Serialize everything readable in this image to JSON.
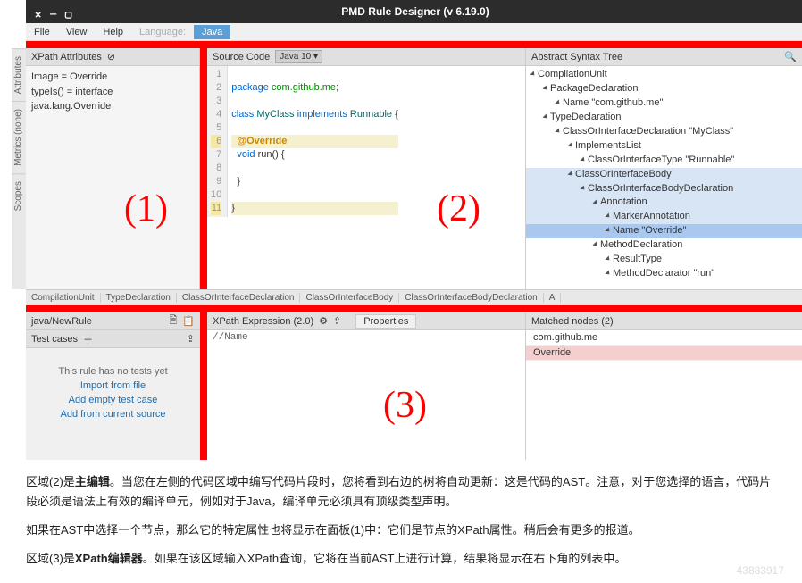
{
  "window": {
    "title": "PMD Rule Designer (v 6.19.0)"
  },
  "menu": {
    "file": "File",
    "view": "View",
    "help": "Help",
    "language": "Language:",
    "java": "Java"
  },
  "sidetabs": {
    "attributes": "Attributes",
    "metrics": "Metrics  (none)",
    "scopes": "Scopes"
  },
  "xpath_attrs": {
    "title": "XPath Attributes",
    "rows": [
      "Image = Override",
      "typeIs() = interface java.lang.Override"
    ]
  },
  "source": {
    "title": "Source Code",
    "lang_dd": "Java 10 ▾",
    "lines": [
      {
        "n": "1",
        "t": ""
      },
      {
        "n": "2",
        "t": "package com.github.me;",
        "cls": "pkg"
      },
      {
        "n": "3",
        "t": ""
      },
      {
        "n": "4",
        "t": "class MyClass implements Runnable {",
        "cls": "cls"
      },
      {
        "n": "5",
        "t": ""
      },
      {
        "n": "6",
        "t": "  @Override",
        "cls": "ann",
        "hl": true
      },
      {
        "n": "7",
        "t": "  void run() {",
        "cls": "kw"
      },
      {
        "n": "8",
        "t": ""
      },
      {
        "n": "9",
        "t": "  }"
      },
      {
        "n": "10",
        "t": ""
      },
      {
        "n": "11",
        "t": "}",
        "hl": true
      }
    ]
  },
  "ast": {
    "title": "Abstract Syntax Tree",
    "nodes": [
      {
        "l": 0,
        "t": "CompilationUnit"
      },
      {
        "l": 1,
        "t": "PackageDeclaration"
      },
      {
        "l": 2,
        "t": "Name \"com.github.me\""
      },
      {
        "l": 1,
        "t": "TypeDeclaration"
      },
      {
        "l": 2,
        "t": "ClassOrInterfaceDeclaration \"MyClass\""
      },
      {
        "l": 3,
        "t": "ImplementsList"
      },
      {
        "l": 4,
        "t": "ClassOrInterfaceType \"Runnable\""
      },
      {
        "l": 3,
        "t": "ClassOrInterfaceBody",
        "hl": 2
      },
      {
        "l": 4,
        "t": "ClassOrInterfaceBodyDeclaration",
        "hl": 2
      },
      {
        "l": 5,
        "t": "Annotation",
        "hl": 2
      },
      {
        "l": 6,
        "t": "MarkerAnnotation",
        "hl": 2
      },
      {
        "l": 6,
        "t": "Name \"Override\"",
        "sel": true
      },
      {
        "l": 5,
        "t": "MethodDeclaration"
      },
      {
        "l": 6,
        "t": "ResultType"
      },
      {
        "l": 6,
        "t": "MethodDeclarator \"run\""
      }
    ]
  },
  "breadcrumb": [
    "CompilationUnit",
    "TypeDeclaration",
    "ClassOrInterfaceDeclaration",
    "ClassOrInterfaceBody",
    "ClassOrInterfaceBodyDeclaration",
    "A"
  ],
  "rule": {
    "path": "java/NewRule",
    "test_title": "Test cases",
    "no_tests": "This rule has no tests yet",
    "import": "Import from file",
    "add_empty": "Add empty test case",
    "add_src": "Add from current source"
  },
  "xpath_expr": {
    "title": "XPath Expression (2.0)",
    "props": "Properties",
    "value": "//Name"
  },
  "matched": {
    "title": "Matched nodes (2)",
    "items": [
      "com.github.me",
      "Override"
    ]
  },
  "regions": {
    "r1": "(1)",
    "r2": "(2)",
    "r3": "(3)"
  },
  "article": {
    "p1a": "区域(2)是",
    "p1b": "主编辑",
    "p1c": "。当您在左侧的代码区域中编写代码片段时，您将看到右边的树将自动更新：这是代码的AST。注意，对于您选择的语言，代码片段必须是语法上有效的编译单元，例如对于Java，编译单元必须具有顶级类型声明。",
    "p2": "如果在AST中选择一个节点，那么它的特定属性也将显示在面板(1)中：它们是节点的XPath属性。稍后会有更多的报道。",
    "p3a": "区域(3)是",
    "p3b": "XPath编辑器",
    "p3c": "。如果在该区域输入XPath查询，它将在当前AST上进行计算，结果将显示在右下角的列表中。"
  },
  "watermark": "43883917"
}
